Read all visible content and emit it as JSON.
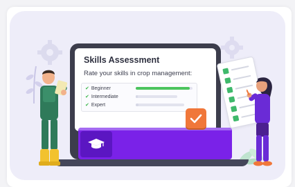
{
  "screen": {
    "title": "Skills Assessment",
    "subtitle": "Rate your skills in crop management:",
    "skills": [
      {
        "label": "Beginner",
        "level": 0.95
      },
      {
        "label": "Intermediate",
        "level": 0.05
      },
      {
        "label": "Expert",
        "level": 0.05
      }
    ]
  },
  "icons": {
    "check": "✔",
    "badge": "checkmark-icon",
    "cap": "graduation-cap-icon"
  },
  "colors": {
    "accent_purple": "#7a22e8",
    "accent_green": "#4cc45e",
    "accent_orange": "#f0773a",
    "background": "#eeedf9"
  }
}
